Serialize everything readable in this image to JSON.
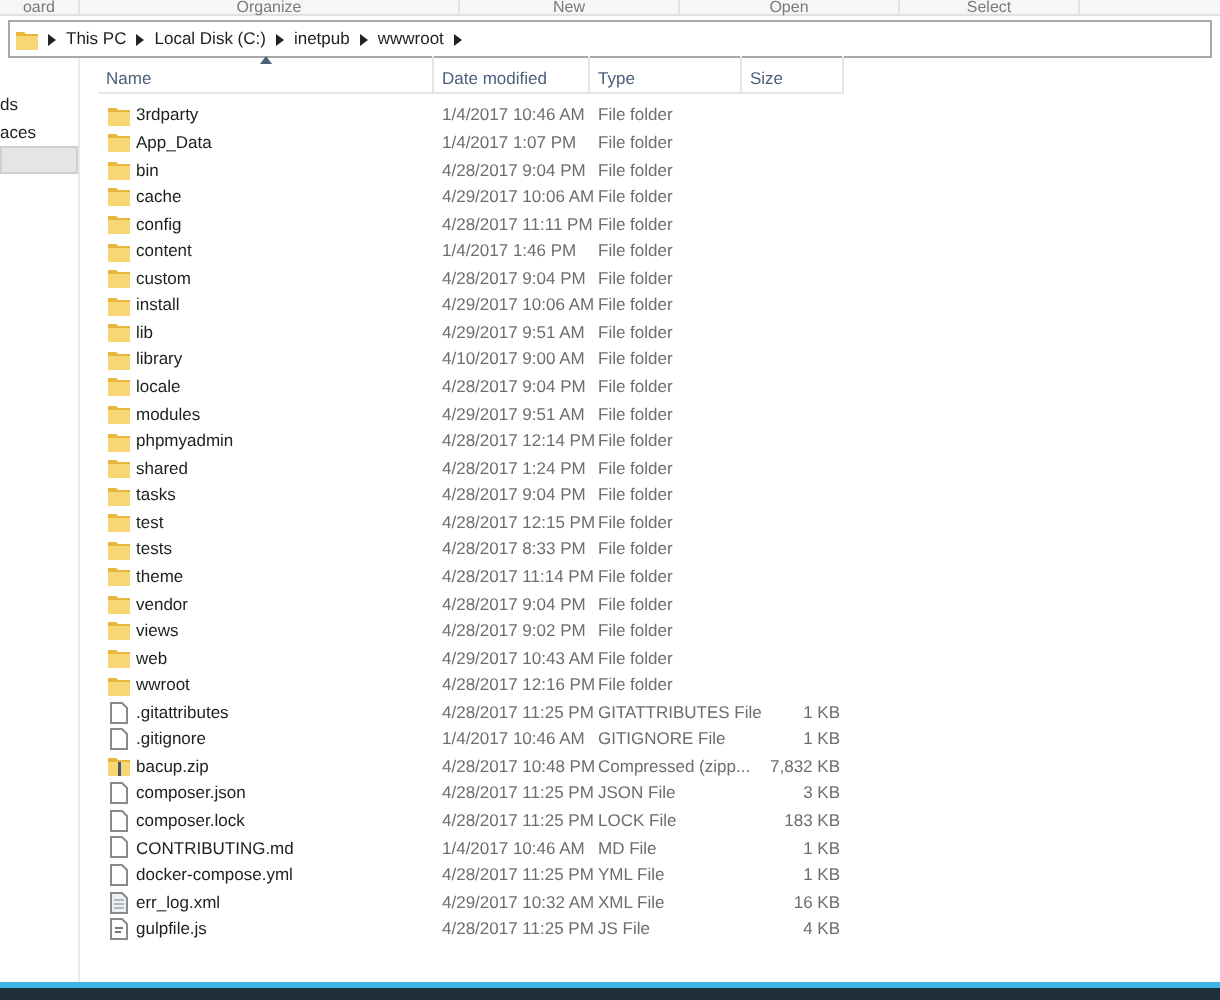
{
  "ribbon_groups": [
    "oard",
    "Organize",
    "New",
    "Open",
    "Select"
  ],
  "address_bar": {
    "crumbs": [
      "This PC",
      "Local Disk (C:)",
      "inetpub",
      "wwwroot"
    ]
  },
  "nav_pane": {
    "items": [
      {
        "label": "ds",
        "selected": false
      },
      {
        "label": "aces",
        "selected": false
      },
      {
        "selected": true
      }
    ]
  },
  "columns": [
    {
      "label": "Name",
      "sorted": true
    },
    {
      "label": "Date modified",
      "sorted": false
    },
    {
      "label": "Type",
      "sorted": false
    },
    {
      "label": "Size",
      "sorted": false
    }
  ],
  "rows": [
    {
      "kind": "folder",
      "name": "3rdparty",
      "date": "1/4/2017 10:46 AM",
      "type": "File folder"
    },
    {
      "kind": "folder",
      "name": "App_Data",
      "date": "1/4/2017 1:07 PM",
      "type": "File folder"
    },
    {
      "kind": "folder",
      "name": "bin",
      "date": "4/28/2017 9:04 PM",
      "type": "File folder"
    },
    {
      "kind": "folder",
      "name": "cache",
      "date": "4/29/2017 10:06 AM",
      "type": "File folder"
    },
    {
      "kind": "folder",
      "name": "config",
      "date": "4/28/2017 11:11 PM",
      "type": "File folder"
    },
    {
      "kind": "folder",
      "name": "content",
      "date": "1/4/2017 1:46 PM",
      "type": "File folder"
    },
    {
      "kind": "folder",
      "name": "custom",
      "date": "4/28/2017 9:04 PM",
      "type": "File folder"
    },
    {
      "kind": "folder",
      "name": "install",
      "date": "4/29/2017 10:06 AM",
      "type": "File folder"
    },
    {
      "kind": "folder",
      "name": "lib",
      "date": "4/29/2017 9:51 AM",
      "type": "File folder"
    },
    {
      "kind": "folder",
      "name": "library",
      "date": "4/10/2017 9:00 AM",
      "type": "File folder"
    },
    {
      "kind": "folder",
      "name": "locale",
      "date": "4/28/2017 9:04 PM",
      "type": "File folder"
    },
    {
      "kind": "folder",
      "name": "modules",
      "date": "4/29/2017 9:51 AM",
      "type": "File folder"
    },
    {
      "kind": "folder",
      "name": "phpmyadmin",
      "date": "4/28/2017 12:14 PM",
      "type": "File folder"
    },
    {
      "kind": "folder",
      "name": "shared",
      "date": "4/28/2017 1:24 PM",
      "type": "File folder"
    },
    {
      "kind": "folder",
      "name": "tasks",
      "date": "4/28/2017 9:04 PM",
      "type": "File folder"
    },
    {
      "kind": "folder",
      "name": "test",
      "date": "4/28/2017 12:15 PM",
      "type": "File folder"
    },
    {
      "kind": "folder",
      "name": "tests",
      "date": "4/28/2017 8:33 PM",
      "type": "File folder"
    },
    {
      "kind": "folder",
      "name": "theme",
      "date": "4/28/2017 11:14 PM",
      "type": "File folder"
    },
    {
      "kind": "folder",
      "name": "vendor",
      "date": "4/28/2017 9:04 PM",
      "type": "File folder"
    },
    {
      "kind": "folder",
      "name": "views",
      "date": "4/28/2017 9:02 PM",
      "type": "File folder"
    },
    {
      "kind": "folder",
      "name": "web",
      "date": "4/29/2017 10:43 AM",
      "type": "File folder"
    },
    {
      "kind": "folder",
      "name": "wwroot",
      "date": "4/28/2017 12:16 PM",
      "type": "File folder"
    },
    {
      "kind": "file",
      "name": ".gitattributes",
      "date": "4/28/2017 11:25 PM",
      "type": "GITATTRIBUTES File",
      "size": "1 KB"
    },
    {
      "kind": "file",
      "name": ".gitignore",
      "date": "1/4/2017 10:46 AM",
      "type": "GITIGNORE File",
      "size": "1 KB"
    },
    {
      "kind": "zip",
      "name": "bacup.zip",
      "date": "4/28/2017 10:48 PM",
      "type": "Compressed (zipp...",
      "size": "7,832 KB"
    },
    {
      "kind": "file",
      "name": "composer.json",
      "date": "4/28/2017 11:25 PM",
      "type": "JSON File",
      "size": "3 KB"
    },
    {
      "kind": "file",
      "name": "composer.lock",
      "date": "4/28/2017 11:25 PM",
      "type": "LOCK File",
      "size": "183 KB"
    },
    {
      "kind": "file",
      "name": "CONTRIBUTING.md",
      "date": "1/4/2017 10:46 AM",
      "type": "MD File",
      "size": "1 KB"
    },
    {
      "kind": "file",
      "name": "docker-compose.yml",
      "date": "4/28/2017 11:25 PM",
      "type": "YML File",
      "size": "1 KB"
    },
    {
      "kind": "xml",
      "name": "err_log.xml",
      "date": "4/29/2017 10:32 AM",
      "type": "XML File",
      "size": "16 KB"
    },
    {
      "kind": "script",
      "name": "gulpfile.js",
      "date": "4/28/2017 11:25 PM",
      "type": "JS File",
      "size": "4 KB"
    }
  ]
}
